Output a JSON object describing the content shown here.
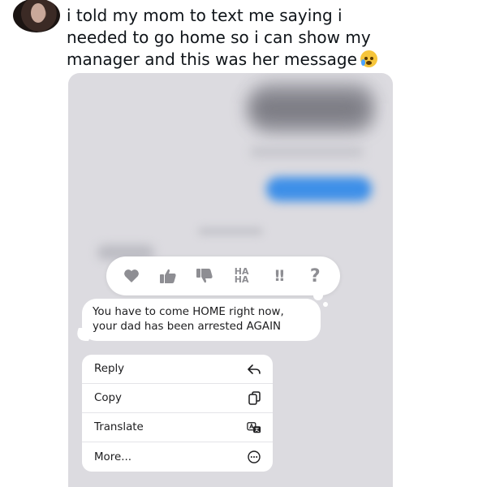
{
  "tweet": {
    "text": "i told my mom to text me saying i needed to go home so i can show my manager and this was her message"
  },
  "icons": {
    "emoji": "loudly-crying-face-emoji",
    "tapbacks": [
      "heart-icon",
      "thumbs-up-icon",
      "thumbs-down-icon",
      "haha-icon",
      "exclamation-icon",
      "question-icon"
    ],
    "menu": [
      "reply-icon",
      "copy-icon",
      "translate-icon",
      "more-icon"
    ]
  },
  "tapback": {
    "haha_line1": "HA",
    "haha_line2": "HA",
    "emphasis": "!!",
    "question": "?"
  },
  "message": {
    "text": "You have to come HOME right now, your dad has been arrested AGAIN"
  },
  "menu": {
    "items": [
      {
        "label": "Reply"
      },
      {
        "label": "Copy"
      },
      {
        "label": "Translate"
      },
      {
        "label": "More..."
      }
    ]
  },
  "colors": {
    "screenshot_bg": "#dcdbe0",
    "tapback_gray": "#8e8e93",
    "imessage_blue": "#3d8fe8"
  }
}
